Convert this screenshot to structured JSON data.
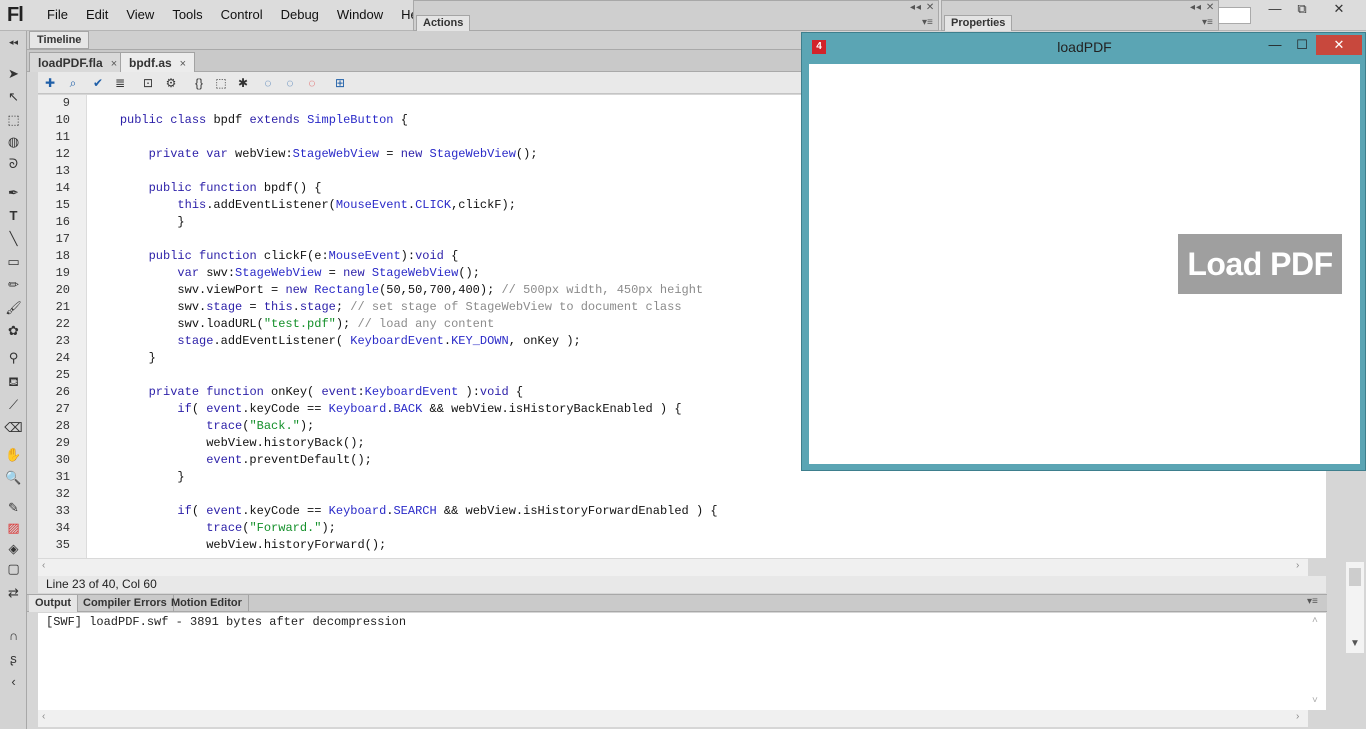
{
  "app": {
    "logo": "Fl"
  },
  "menu": [
    "File",
    "Edit",
    "View",
    "Tools",
    "Control",
    "Debug",
    "Window",
    "Help"
  ],
  "panels": {
    "actions": "Actions",
    "properties": "Properties",
    "timeline": "Timeline"
  },
  "doc_tabs": [
    {
      "label": "loadPDF.fla",
      "close": "×"
    },
    {
      "label": "bpdf.as",
      "close": "×"
    }
  ],
  "code": {
    "lines": [
      {
        "n": "9",
        "t": ""
      },
      {
        "n": "10",
        "t": "    public class bpdf extends SimpleButton {"
      },
      {
        "n": "11",
        "t": ""
      },
      {
        "n": "12",
        "t": "        private var webView:StageWebView = new StageWebView();"
      },
      {
        "n": "13",
        "t": ""
      },
      {
        "n": "14",
        "t": "        public function bpdf() {"
      },
      {
        "n": "15",
        "t": "            this.addEventListener(MouseEvent.CLICK,clickF);"
      },
      {
        "n": "16",
        "t": "            }"
      },
      {
        "n": "17",
        "t": ""
      },
      {
        "n": "18",
        "t": "        public function clickF(e:MouseEvent):void {"
      },
      {
        "n": "19",
        "t": "            var swv:StageWebView = new StageWebView();"
      },
      {
        "n": "20",
        "t": "            swv.viewPort = new Rectangle(50,50,700,400); // 500px width, 450px height"
      },
      {
        "n": "21",
        "t": "            swv.stage = this.stage; // set stage of StageWebView to document class"
      },
      {
        "n": "22",
        "t": "            swv.loadURL(\"test.pdf\"); // load any content"
      },
      {
        "n": "23",
        "t": "            stage.addEventListener( KeyboardEvent.KEY_DOWN, onKey );"
      },
      {
        "n": "24",
        "t": "        }"
      },
      {
        "n": "25",
        "t": ""
      },
      {
        "n": "26",
        "t": "        private function onKey( event:KeyboardEvent ):void {"
      },
      {
        "n": "27",
        "t": "            if( event.keyCode == Keyboard.BACK && webView.isHistoryBackEnabled ) {"
      },
      {
        "n": "28",
        "t": "                trace(\"Back.\");"
      },
      {
        "n": "29",
        "t": "                webView.historyBack();"
      },
      {
        "n": "30",
        "t": "                event.preventDefault();"
      },
      {
        "n": "31",
        "t": "            }"
      },
      {
        "n": "32",
        "t": ""
      },
      {
        "n": "33",
        "t": "            if( event.keyCode == Keyboard.SEARCH && webView.isHistoryForwardEnabled ) {"
      },
      {
        "n": "34",
        "t": "                trace(\"Forward.\");"
      },
      {
        "n": "35",
        "t": "                webView.historyForward();"
      }
    ]
  },
  "status": {
    "text": "Line 23 of 40, Col 60"
  },
  "output_tabs": [
    "Output",
    "Compiler Errors",
    "Motion Editor"
  ],
  "output": {
    "text": "[SWF] loadPDF.swf - 3891 bytes after decompression"
  },
  "pdf_window": {
    "title": "loadPDF",
    "icon": "4",
    "button_label": "Load PDF",
    "controls": {
      "minimize": "—",
      "maximize": "☐",
      "close": "✕"
    }
  },
  "main_window_controls": {
    "minimize": "—",
    "restore": "⧉",
    "close": "✕"
  },
  "icons": [
    "arrow-icon",
    "subselect-icon",
    "free-transform-icon",
    "3d-rotation-icon",
    "lasso-icon",
    "pen-icon",
    "text-icon",
    "line-icon",
    "rectangle-icon",
    "pencil-icon",
    "brush-icon",
    "deco-icon",
    "bone-icon",
    "paint-bucket-icon",
    "eyedropper-icon",
    "eraser-icon",
    "hand-icon",
    "zoom-icon",
    "stroke-color-icon",
    "fill-color-icon"
  ],
  "colors": {
    "keyword": "#2b1fa8",
    "string": "#14902a",
    "comment": "#8b8b8b",
    "window_frame": "#5ba5b4",
    "button": "#9f9f9f"
  }
}
